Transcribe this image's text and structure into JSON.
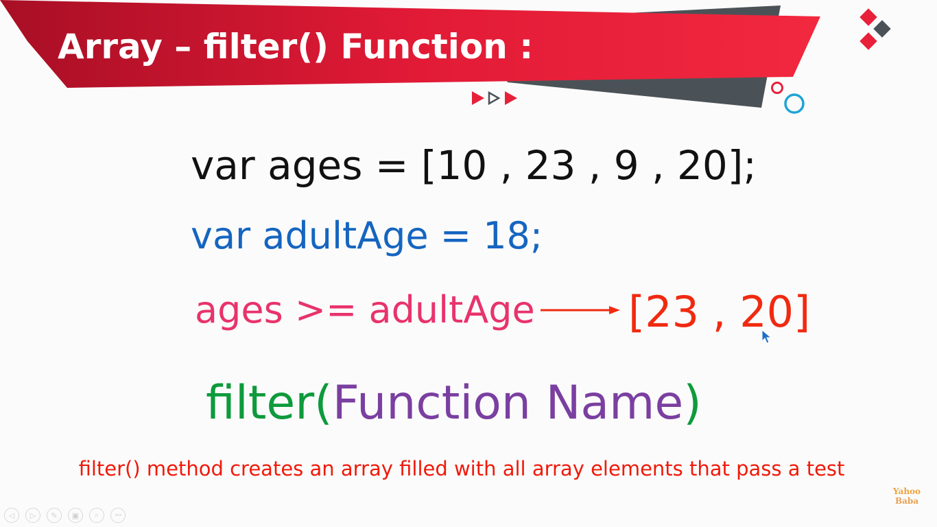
{
  "slide": {
    "title": "Array – filter() Function :",
    "line1": "var ages = [10 , 23 , 9 , 20];",
    "line2": "var adultAge = 18;",
    "line3": "ages >= adultAge",
    "result": "[23 , 20]",
    "filter_keyword": "filter(",
    "filter_param": "Function Name",
    "filter_close": ")",
    "caption": "filter() method creates an array filled with all array elements that pass a test"
  },
  "logo": {
    "line1": "Yahoo",
    "line2": "Baba"
  },
  "player_controls": [
    {
      "name": "previous-slide-icon",
      "glyph": "◁"
    },
    {
      "name": "next-slide-icon",
      "glyph": "▷"
    },
    {
      "name": "pen-icon",
      "glyph": "✎"
    },
    {
      "name": "slides-grid-icon",
      "glyph": "▣"
    },
    {
      "name": "zoom-icon",
      "glyph": "⌕"
    },
    {
      "name": "more-options-icon",
      "glyph": "•••"
    }
  ],
  "colors": {
    "banner_red": "#e8203a",
    "banner_dark": "#b31129",
    "banner_grey": "#4b5257",
    "code_blue": "#1565c0",
    "code_pink": "#e8336b",
    "result_red": "#f02a10",
    "green": "#0e9a3c",
    "purple": "#7a3fa0",
    "accent_cyan": "#1fa3d6"
  }
}
